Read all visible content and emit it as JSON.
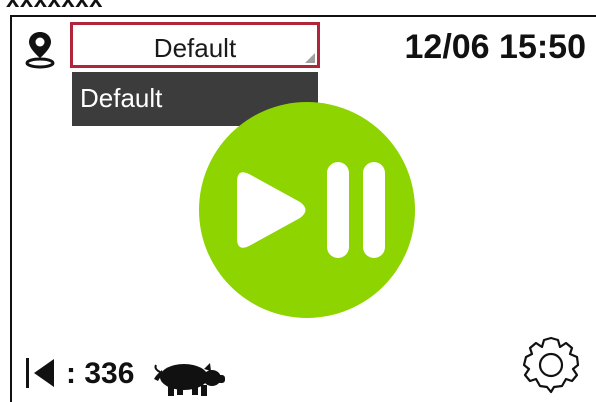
{
  "top_cut_text": "xxxxxxx",
  "location": {
    "icon": "location-pin-icon",
    "selected": "Default",
    "options": [
      "Default"
    ]
  },
  "datetime": "12/06 15:50",
  "play_pause": {
    "icon": "play-pause-icon",
    "color": "#8dd400"
  },
  "counter": {
    "prefix": ": ",
    "value": "336",
    "back_icon": "back-arrow-icon",
    "animal_icon": "pig-icon"
  },
  "settings": {
    "icon": "gear-icon"
  },
  "colors": {
    "accent_border": "#b0253a",
    "dropdown_bg": "#3c3c3c",
    "play_green": "#8dd400"
  }
}
